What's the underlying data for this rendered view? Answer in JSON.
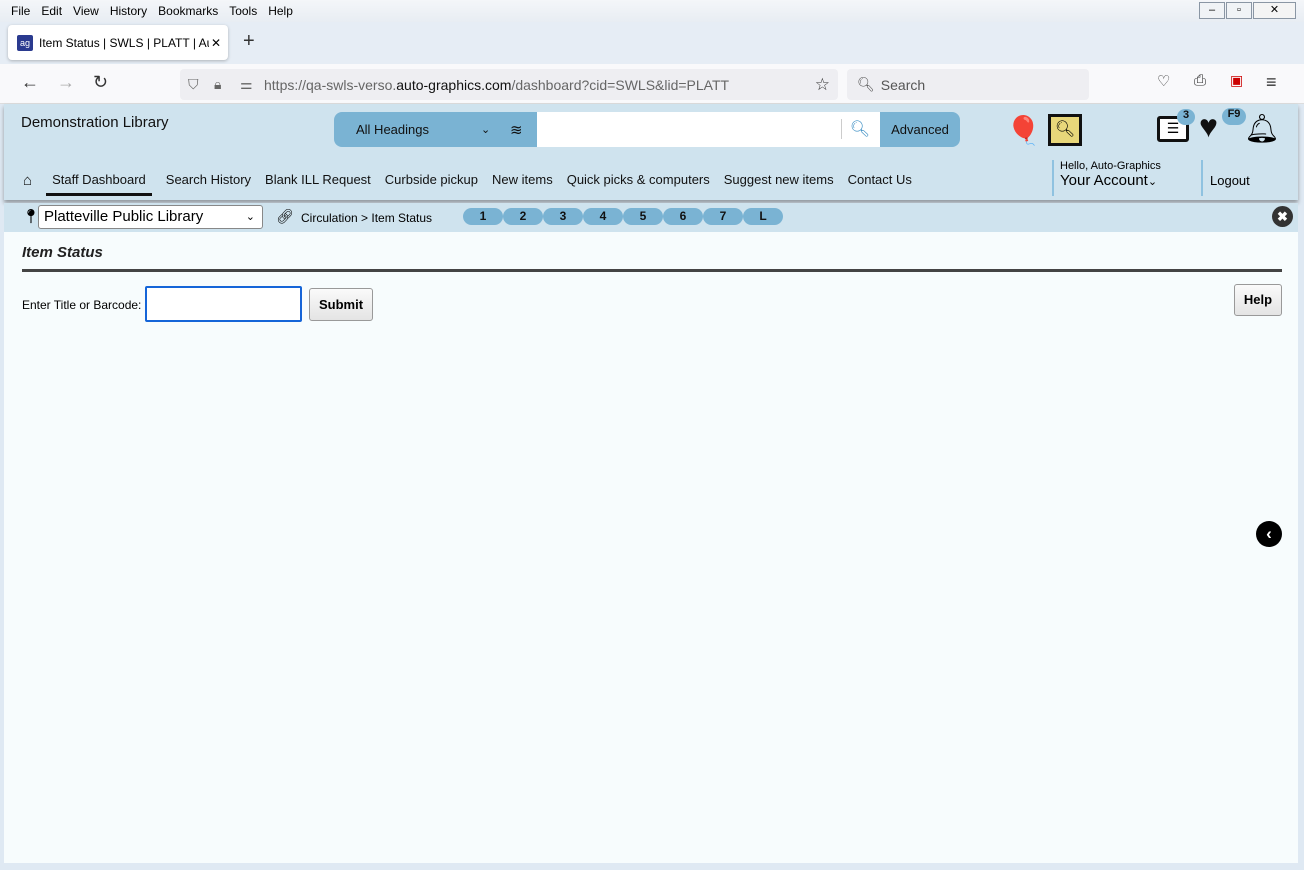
{
  "browser": {
    "menu": [
      "File",
      "Edit",
      "View",
      "History",
      "Bookmarks",
      "Tools",
      "Help"
    ],
    "tab_title": "Item Status | SWLS | PLATT | Aut",
    "url_prefix": "https://qa-swls-verso.",
    "url_domain": "auto-graphics.com",
    "url_suffix": "/dashboard?cid=SWLS&lid=PLATT",
    "search_placeholder": "Search"
  },
  "header": {
    "library_name": "Demonstration Library",
    "heading_select": "All Headings",
    "search_value": "",
    "advanced_label": "Advanced",
    "list_badge": "3",
    "favorites_badge": "F9",
    "greeting": "Hello, Auto-Graphics",
    "account_label": "Your Account",
    "logout_label": "Logout"
  },
  "nav": [
    "Staff Dashboard",
    "Search History",
    "Blank ILL Request",
    "Curbside pickup",
    "New items",
    "Quick picks & computers",
    "Suggest new items",
    "Contact Us"
  ],
  "crumbs": {
    "library_select": "Platteville Public Library",
    "path": "Circulation > Item Status",
    "pills": [
      "1",
      "2",
      "3",
      "4",
      "5",
      "6",
      "7",
      "L"
    ]
  },
  "page": {
    "title": "Item Status",
    "field_label": "Enter Title or Barcode:",
    "field_value": "",
    "submit_label": "Submit",
    "help_label": "Help"
  },
  "colors": {
    "accent": "#7ab3d3",
    "header_bg": "#cfe3ee"
  }
}
